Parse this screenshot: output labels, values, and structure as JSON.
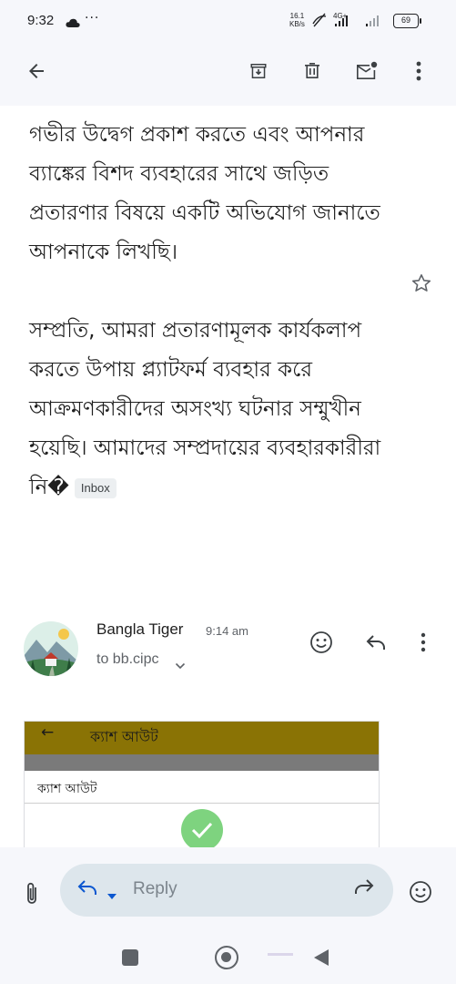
{
  "status_bar": {
    "time": "9:32",
    "dots": "···",
    "net_speed_value": "16.1",
    "net_speed_unit": "KB/s",
    "network": "4G+",
    "battery": "69"
  },
  "toolbar": {
    "back_icon": "arrow-back-icon",
    "archive_icon": "archive-icon",
    "delete_icon": "delete-icon",
    "mark_unread_icon": "mark-unread-icon",
    "more_icon": "more-vert-icon"
  },
  "message": {
    "body_paragraphs": [
      "বাংলা কাস্টমার সার্ভিস এ প্রধান, আমাদের গভীর উদ্বেগ প্রকাশ করতে এবং আপনার ব্যাঙ্কের বিশদ ব্যবহারের সাথে জড়িত প্রতারণার বিষয়ে একটি অভিযোগ জানাতে আপনাকে লিখছি।",
      "সম্প্রতি, আমরা প্রতারণামূলক কার্যকলাপ করতে উপায় প্ল্যাটফর্ম ব্যবহার করে আক্রমণকারীদের অসংখ্য ঘটনার সম্মুখীন হয়েছি। আমাদের সম্প্রদায়ের ব্যবহারকারীরা নি�"
    ],
    "label_chip": "Inbox",
    "star_icon": "star-outline-icon"
  },
  "sender": {
    "name": "Bangla Tiger",
    "time": "9:14 am",
    "recipient": "to bb.cipc",
    "avatar_icon": "landscape-avatar-icon"
  },
  "attachment_preview": {
    "back_arrow": "←",
    "header_title": "ক্যাশ আউট",
    "section_label": "ক্যাশ আউট",
    "check_icon": "check-circle-icon"
  },
  "reply_bar": {
    "placeholder": "Reply",
    "attach_icon": "attach-file-icon",
    "forward_icon": "forward-icon",
    "emoji_icon": "emoji-icon"
  },
  "colors": {
    "accent": "#0b57d0",
    "attachment_header": "#8a7305",
    "check_green": "#7ed37f",
    "reply_pill": "#dde6ec"
  }
}
